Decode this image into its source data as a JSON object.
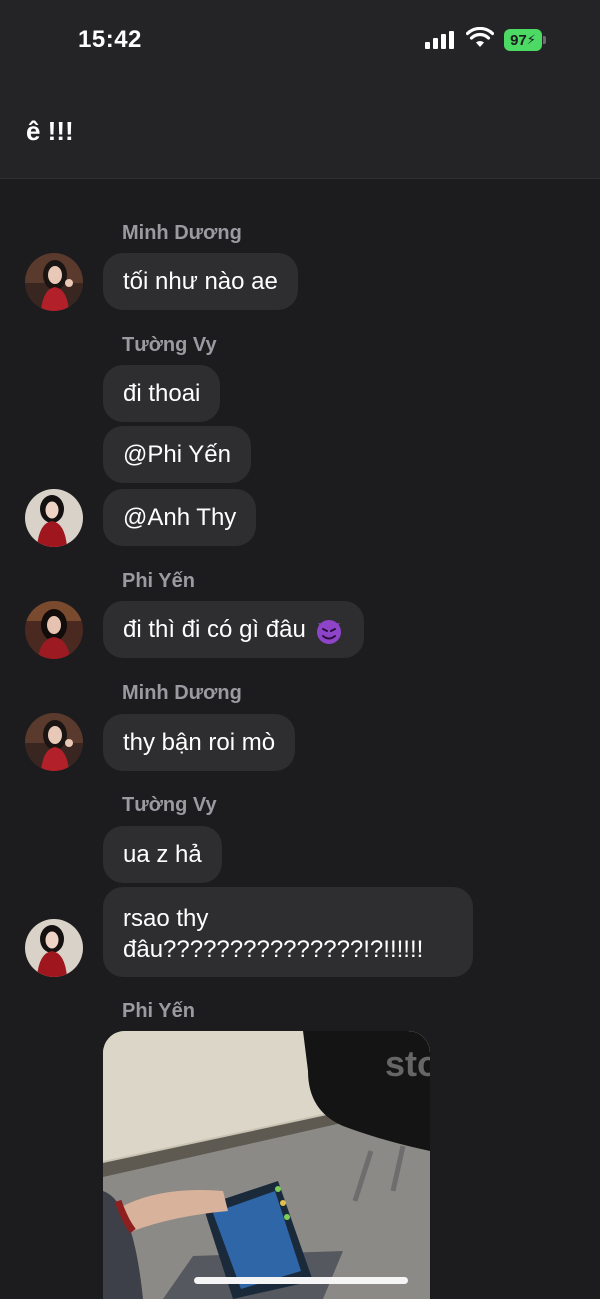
{
  "status_bar": {
    "time": "15:42",
    "battery": "97"
  },
  "header": {
    "title": "ê !!!"
  },
  "messages": [
    {
      "sender": "Minh Dương",
      "texts": [
        "tối như nào ae"
      ]
    },
    {
      "sender": "Tường Vy",
      "texts": [
        "đi thoai",
        "@Phi Yến",
        "@Anh Thy"
      ]
    },
    {
      "sender": "Phi Yến",
      "texts": [
        "đi thì đi có gì đâu"
      ],
      "emoji": "devil-icon"
    },
    {
      "sender": "Minh Dương",
      "texts": [
        "thy bận roi mò"
      ]
    },
    {
      "sender": "Tường Vy",
      "texts": [
        "ua z hả",
        "rsao thy đâu???????????????!?!!!!!!"
      ]
    },
    {
      "sender": "Phi Yến",
      "attachment": "photo",
      "watermark": "story"
    }
  ],
  "colors": {
    "background": "#1c1c1e",
    "bubble": "#2e2e30",
    "sender": "#9a9aa0",
    "battery": "#4cd964"
  }
}
